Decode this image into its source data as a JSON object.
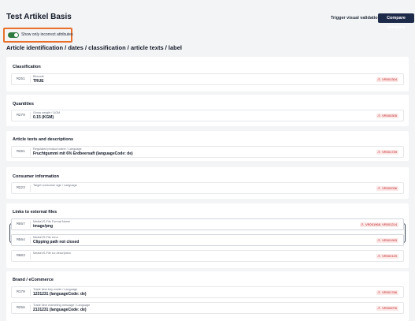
{
  "header": {
    "title": "Test Artikel Basis",
    "trigger_label": "Trigger visual validation",
    "compare_label": "Compare versions"
  },
  "filter": {
    "toggle_label": "Show only incorrect attributes",
    "toggle_on": true
  },
  "section_heading": "Article identification / dates / classification / article texts / label",
  "cards": {
    "classification": {
      "title": "Classification",
      "rows": [
        {
          "code": "M251",
          "label": "Biocode",
          "value": "TRUE",
          "badge": "VR001304"
        }
      ]
    },
    "quantities": {
      "title": "Quantities",
      "rows": [
        {
          "code": "M279",
          "label": "Gross weight / UOM",
          "value": "0.15 (KGM)",
          "badge": "VR000305"
        }
      ]
    },
    "article_texts": {
      "title": "Article texts and descriptions",
      "rows": [
        {
          "code": "M261",
          "label": "Regulated product name / Language",
          "value": "Fruchtgummi mit 6% Erdbeersaft (languageCode: de)",
          "badge": "VR001739"
        }
      ]
    },
    "consumer": {
      "title": "Consumer information",
      "rows": [
        {
          "code": "M223",
          "label": "Target consumer age / Language",
          "value": "",
          "badge": "VR002036"
        }
      ]
    },
    "links": {
      "title": "Links to external files",
      "rows": [
        {
          "code": "M557",
          "label": "MediaVS-File Format Name",
          "value": "image/png",
          "badge": "VR001968, VR001214"
        },
        {
          "code": "M564",
          "label": "MediaVS-File error",
          "value": "Clipping path not closed",
          "badge": "VR001993"
        },
        {
          "code": "M603",
          "label": "MediaVS-File icc description",
          "value": "",
          "badge": "VR002129"
        }
      ]
    },
    "brand": {
      "title": "Brand / eCommerce",
      "rows": [
        {
          "code": "M170",
          "label": "Trade item key words / Language",
          "value": "1231231 (languageCode: de)",
          "badge": "VR001766"
        },
        {
          "code": "M256",
          "label": "Trade item marketing message / Language",
          "value": "2131231 (languageCode: de)",
          "badge": "VR000076"
        }
      ]
    }
  },
  "colors": {
    "accent": "#1e2a4a",
    "toggle": "#2f7a3f",
    "highlight": "#e8702a",
    "error": "#b91c1c"
  }
}
